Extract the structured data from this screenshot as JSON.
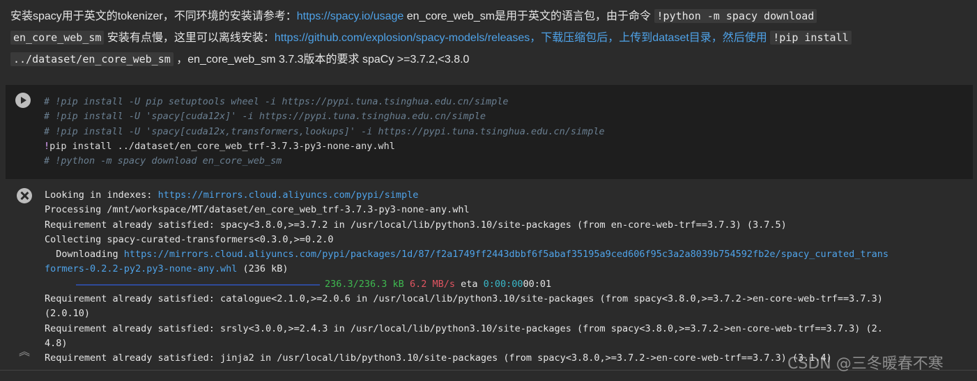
{
  "markdown": {
    "p1_text": "安装spacy用于英文的tokenizer，不同环境的安装请参考：",
    "p1_link": "https://spacy.io/usage",
    "p1_text2": " en_core_web_sm是用于英文的语言包，由于命令 ",
    "p1_code": "!python -m spacy download",
    "p2_code": "en_core_web_sm",
    "p2_text": " 安装有点慢，这里可以离线安装：",
    "p2_link": "https://github.com/explosion/spacy-models/releases，下载压缩包后，上传到dataset目录，然后使用",
    "p2_code2": "!pip install",
    "p3_code": "../dataset/en_core_web_sm",
    "p3_text": " ，en_core_web_sm 3.7.3版本的要求 spaCy >=3.7.2,<3.8.0"
  },
  "code_cell": {
    "line1": "# !pip install -U pip setuptools wheel -i https://pypi.tuna.tsinghua.edu.cn/simple",
    "line2": "# !pip install -U 'spacy[cuda12x]' -i https://pypi.tuna.tsinghua.edu.cn/simple",
    "line3": "# !pip install -U 'spacy[cuda12x,transformers,lookups]' -i https://pypi.tuna.tsinghua.edu.cn/simple",
    "line4_bang": "!",
    "line4_cmd": "pip install ../dataset/en_core_web_trf-3.7.3-py3-none-any.whl",
    "line5": "# !python -m spacy download en_core_web_sm"
  },
  "output": {
    "l1_text": "Looking in indexes: ",
    "l1_link": "https://mirrors.cloud.aliyuncs.com/pypi/simple",
    "l2": "Processing /mnt/workspace/MT/dataset/en_core_web_trf-3.7.3-py3-none-any.whl",
    "l3": "Requirement already satisfied: spacy<3.8.0,>=3.7.2 in /usr/local/lib/python3.10/site-packages (from en-core-web-trf==3.7.3) (3.7.5)",
    "l4": "Collecting spacy-curated-transformers<0.3.0,>=0.2.0",
    "l5_text": "  Downloading ",
    "l5_link": "https://mirrors.cloud.aliyuncs.com/pypi/packages/1d/87/f2a1749ff2443dbbf6f5abaf35195a9ced606f95c3a2a8039b754592fb2e/spacy_curated_trans",
    "l6_link": "formers-0.2.2-py2.py3-none-any.whl",
    "l6_text": " (236 kB)",
    "progress_size": "236.3/236.3 kB",
    "progress_speed": "6.2 MB/s",
    "progress_eta_label": "eta",
    "progress_eta": "0:00:00",
    "progress_elapsed": "00:01",
    "progress_fraction": 1.0,
    "l8": "Requirement already satisfied: catalogue<2.1.0,>=2.0.6 in /usr/local/lib/python3.10/site-packages (from spacy<3.8.0,>=3.7.2->en-core-web-trf==3.7.3)",
    "l9": "(2.0.10)",
    "l10": "Requirement already satisfied: srsly<3.0.0,>=2.4.3 in /usr/local/lib/python3.10/site-packages (from spacy<3.8.0,>=3.7.2->en-core-web-trf==3.7.3) (2.",
    "l11": "4.8)",
    "l12": "Requirement already satisfied: jinja2 in /usr/local/lib/python3.10/site-packages (from spacy<3.8.0,>=3.7.2->en-core-web-trf==3.7.3) (3.1.4)"
  },
  "watermark": "CSDN @三冬暖春不寒",
  "icons": {
    "run": "play-icon",
    "error": "close-circle-icon",
    "collapse": "chevron-double-up-icon"
  }
}
